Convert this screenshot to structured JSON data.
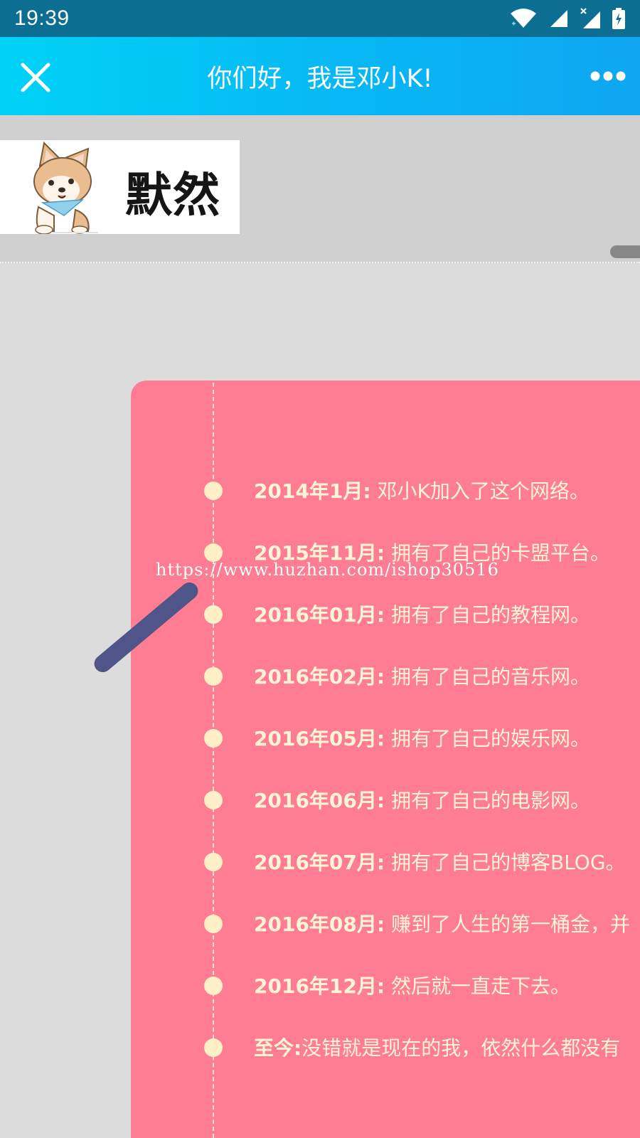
{
  "status_bar": {
    "time": "19:39",
    "icons": [
      "wifi-icon",
      "signal-icon",
      "signal-x-icon",
      "battery-charging-icon"
    ]
  },
  "header": {
    "title": "你们好，我是邓小K!",
    "close_icon": "close-icon",
    "more_icon": "more-dots-icon",
    "gradient_start": "#00d2f7",
    "gradient_end": "#0ea6f1"
  },
  "logo": {
    "text": "默然",
    "mascot": "shiba-dog-icon"
  },
  "watermark": {
    "text": "https://www.huzhan.com/ishop30516"
  },
  "timeline": {
    "card_color": "#ff7d92",
    "text_color": "#fff3d7",
    "items": [
      {
        "date": "2014年1月:",
        "text": " 邓小K加入了这个网络。"
      },
      {
        "date": "2015年11月:",
        "text": " 拥有了自己的卡盟平台。"
      },
      {
        "date": "2016年01月:",
        "text": " 拥有了自己的教程网。"
      },
      {
        "date": "2016年02月:",
        "text": " 拥有了自己的音乐网。"
      },
      {
        "date": "2016年05月:",
        "text": " 拥有了自己的娱乐网。"
      },
      {
        "date": "2016年06月:",
        "text": " 拥有了自己的电影网。"
      },
      {
        "date": "2016年07月:",
        "text": " 拥有了自己的博客BLOG。"
      },
      {
        "date": "2016年08月:",
        "text": " 赚到了人生的第一桶金，并"
      },
      {
        "date": "2016年12月:",
        "text": " 然后就一直走下去。"
      },
      {
        "date": "至今:",
        "text": "没错就是现在的我，依然什么都没有"
      }
    ]
  }
}
